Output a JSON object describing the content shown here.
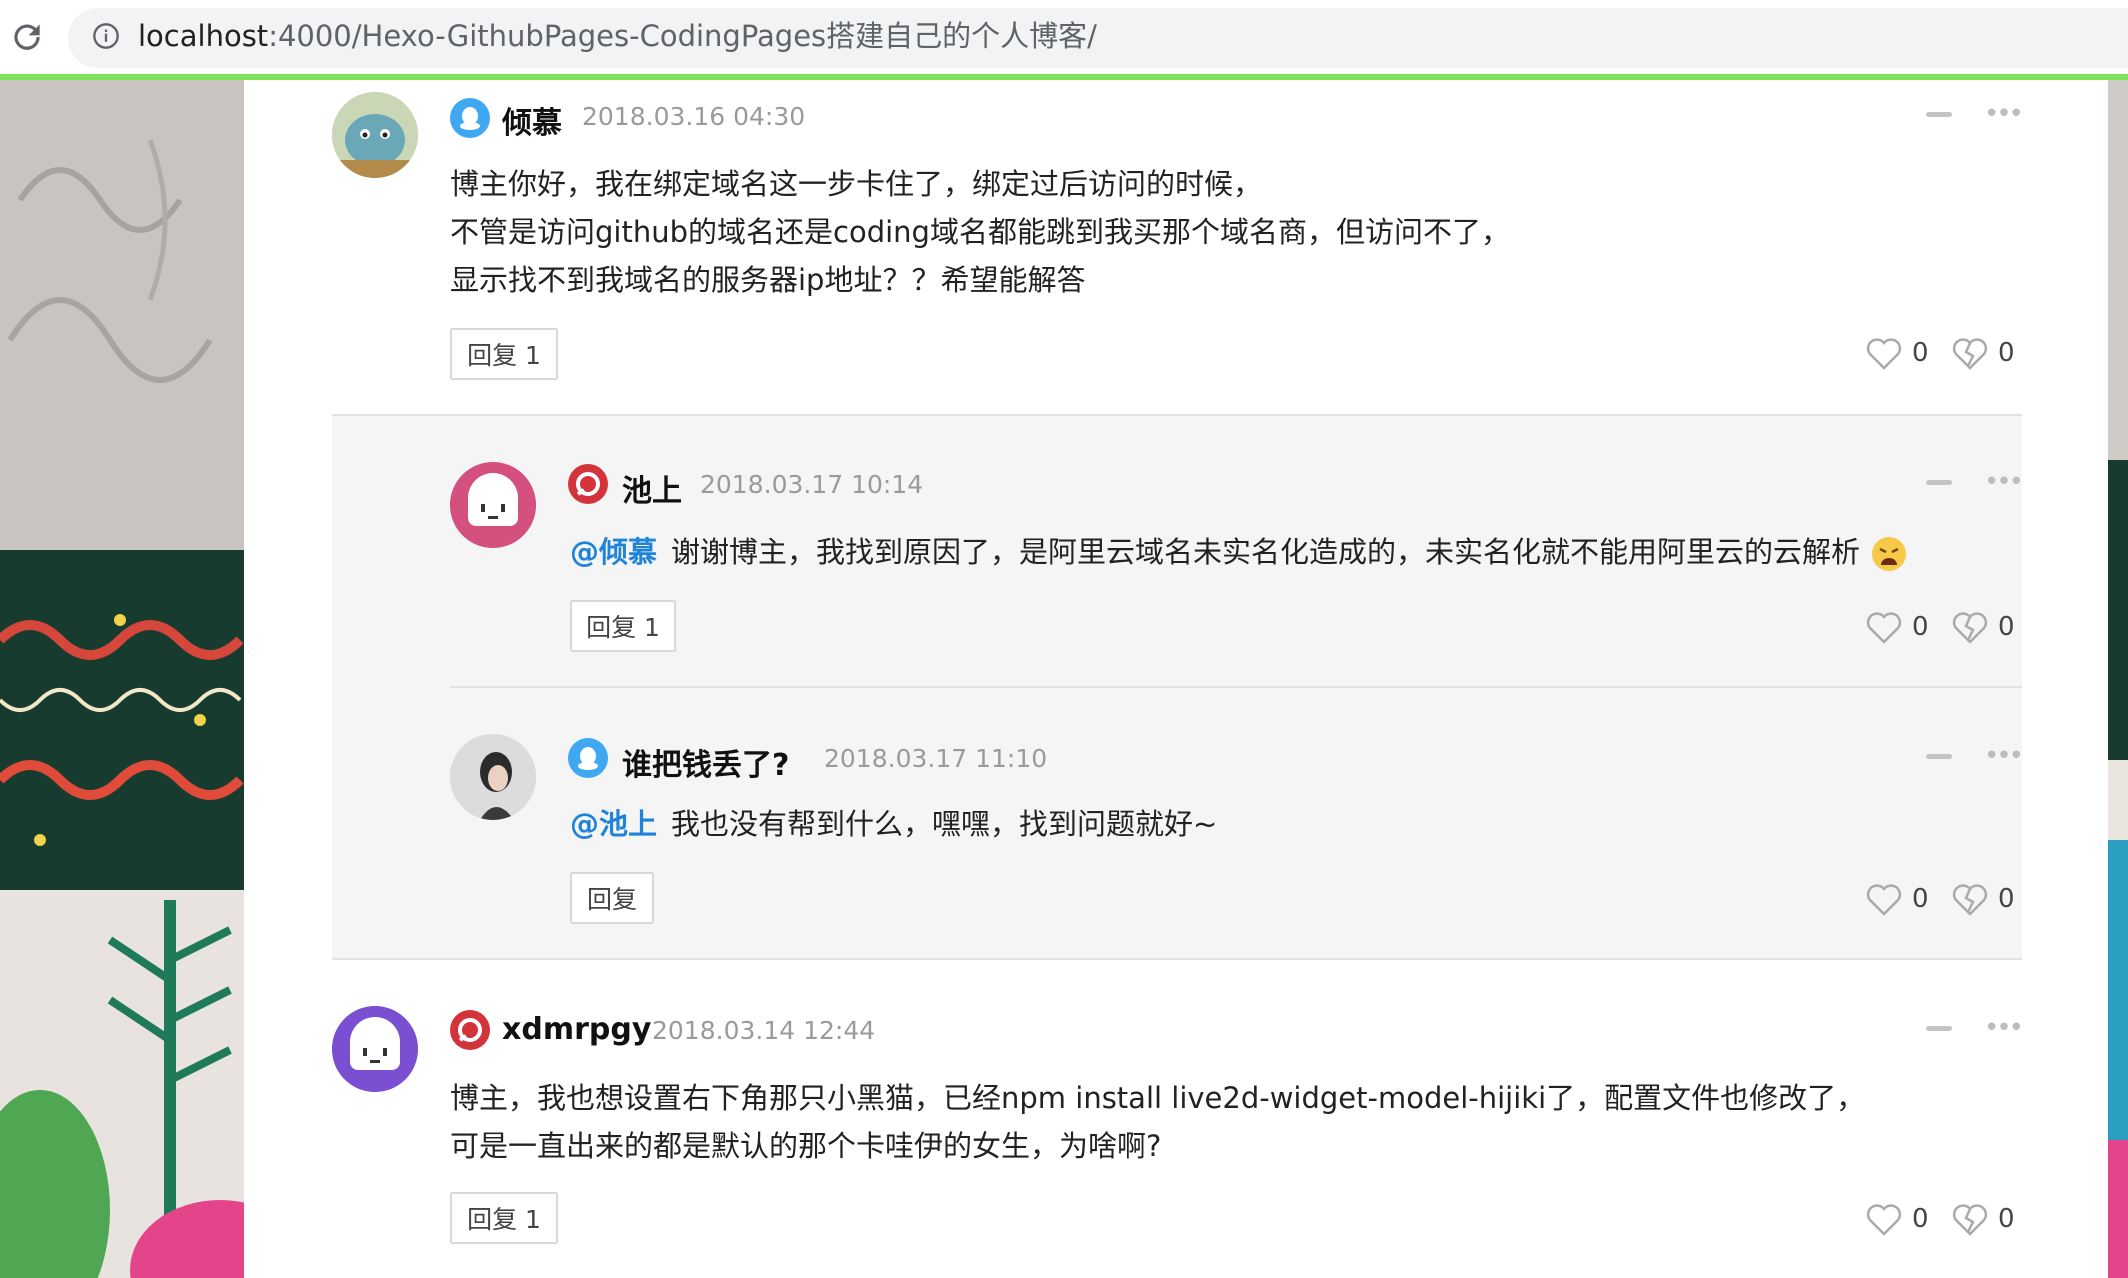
{
  "browser": {
    "url_host": "localhost",
    "url_path": ":4000/Hexo-GithubPages-CodingPages搭建自己的个人博客/"
  },
  "comments": [
    {
      "author": "倾慕",
      "time": "2018.03.16 04:30",
      "platform_icon": "qq-icon",
      "lines": [
        "博主你好，我在绑定域名这一步卡住了，绑定过后访问的时候，",
        "不管是访问github的域名还是coding域名都能跳到我买那个域名商，但访问不了，",
        "显示找不到我域名的服务器ip地址？？希望能解答"
      ],
      "reply_label": "回复 1",
      "likes": "0",
      "dislikes": "0"
    },
    {
      "author": "池上",
      "time": "2018.03.17 10:14",
      "platform_icon": "weibo-icon",
      "mention": "@倾慕",
      "text": "谢谢博主，我找到原因了，是阿里云域名未实名化造成的，未实名化就不能用阿里云的云解析",
      "reply_label": "回复 1",
      "likes": "0",
      "dislikes": "0"
    },
    {
      "author": "谁把钱丢了?",
      "time": "2018.03.17 11:10",
      "platform_icon": "qq-icon",
      "mention": "@池上",
      "text": "我也没有帮到什么，嘿嘿，找到问题就好~",
      "reply_label": "回复",
      "likes": "0",
      "dislikes": "0"
    },
    {
      "author": "xdmrpgy",
      "time": "2018.03.14 12:44",
      "platform_icon": "weibo-icon",
      "lines": [
        "博主，我也想设置右下角那只小黑猫，已经npm install live2d-widget-model-hijiki了，配置文件也修改了，",
        "可是一直出来的都是默认的那个卡哇伊的女生，为啥啊?"
      ],
      "reply_label": "回复 1",
      "likes": "0",
      "dislikes": "0"
    }
  ],
  "colors": {
    "accent_link": "#1f84d8",
    "progress": "#7ee15a",
    "qq_blue": "#3ea8f2",
    "weibo_red": "#d3333a",
    "avatar_pink": "#d3507f",
    "avatar_purple": "#7a4fd1"
  }
}
